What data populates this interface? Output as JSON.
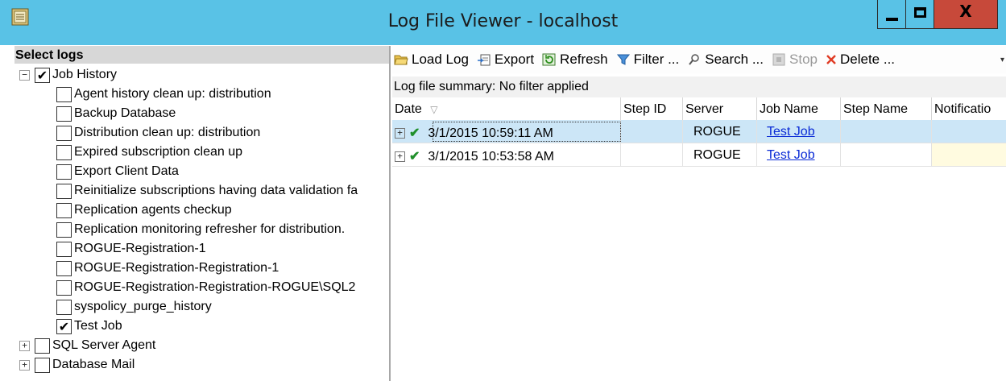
{
  "window": {
    "title": "Log File Viewer - localhost",
    "close_glyph": "X"
  },
  "left": {
    "header": "Select logs",
    "root": {
      "label": "Job History",
      "checked": true,
      "expanded": true
    },
    "jobs": [
      {
        "label": "Agent history clean up: distribution",
        "checked": false
      },
      {
        "label": "Backup Database",
        "checked": false
      },
      {
        "label": "Distribution clean up: distribution",
        "checked": false
      },
      {
        "label": "Expired subscription clean up",
        "checked": false
      },
      {
        "label": "Export Client Data",
        "checked": false
      },
      {
        "label": "Reinitialize subscriptions having data validation fa",
        "checked": false
      },
      {
        "label": "Replication agents checkup",
        "checked": false
      },
      {
        "label": "Replication monitoring refresher for distribution.",
        "checked": false
      },
      {
        "label": "ROGUE-Registration-1",
        "checked": false
      },
      {
        "label": "ROGUE-Registration-Registration-1",
        "checked": false
      },
      {
        "label": "ROGUE-Registration-Registration-ROGUE\\SQL2",
        "checked": false
      },
      {
        "label": "syspolicy_purge_history",
        "checked": false
      },
      {
        "label": "Test Job",
        "checked": true
      }
    ],
    "others": [
      {
        "label": "SQL Server Agent",
        "checked": false
      },
      {
        "label": "Database Mail",
        "checked": false
      }
    ]
  },
  "toolbar": {
    "load_log": "Load Log",
    "export": "Export",
    "refresh": "Refresh",
    "filter": "Filter ...",
    "search": "Search ...",
    "stop": "Stop",
    "delete": "Delete ..."
  },
  "summary": "Log file summary: No filter applied",
  "grid": {
    "columns": [
      "Date",
      "Step ID",
      "Server",
      "Job Name",
      "Step Name",
      "Notificatio"
    ],
    "rows": [
      {
        "date": "3/1/2015 10:59:11 AM",
        "step_id": "",
        "server": "ROGUE",
        "job_name": "Test Job",
        "step_name": "",
        "selected": true
      },
      {
        "date": "3/1/2015 10:53:58 AM",
        "step_id": "",
        "server": "ROGUE",
        "job_name": "Test Job",
        "step_name": "",
        "selected": false
      }
    ]
  },
  "colors": {
    "titlebar": "#59c2e6",
    "close_button": "#c7493a",
    "selected_row": "#cce6f7",
    "link": "#0a2bd6"
  }
}
